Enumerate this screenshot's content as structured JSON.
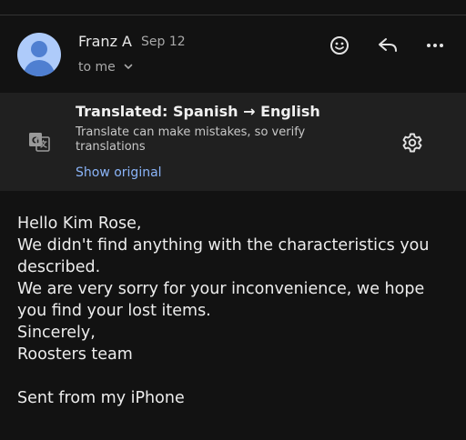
{
  "email": {
    "sender_name": "Franz A",
    "date": "Sep 12",
    "recipient": "to me"
  },
  "actions": {
    "emoji_icon": "add-reaction-icon",
    "reply_icon": "reply-icon",
    "more_icon": "more-options-icon"
  },
  "translation": {
    "title": "Translated: Spanish → English",
    "note": "Translate can make mistakes, so verify translations",
    "show_original": "Show original",
    "icon": "translate-icon",
    "settings_icon": "gear-icon"
  },
  "body": {
    "greeting": "Hello Kim Rose,",
    "line1": "We didn't find anything with the characteristics you",
    "line2": "described.",
    "line3": "We are very sorry for your inconvenience, we hope",
    "line4": "you find your lost items.",
    "closing": "Sincerely,",
    "signature": "Roosters team",
    "footer": "Sent from my iPhone"
  },
  "colors": {
    "background": "#121212",
    "banner": "#202020",
    "link": "#8ab4f8",
    "avatar_bg": "#aecbfa",
    "avatar_fg": "#4f7fd1"
  }
}
